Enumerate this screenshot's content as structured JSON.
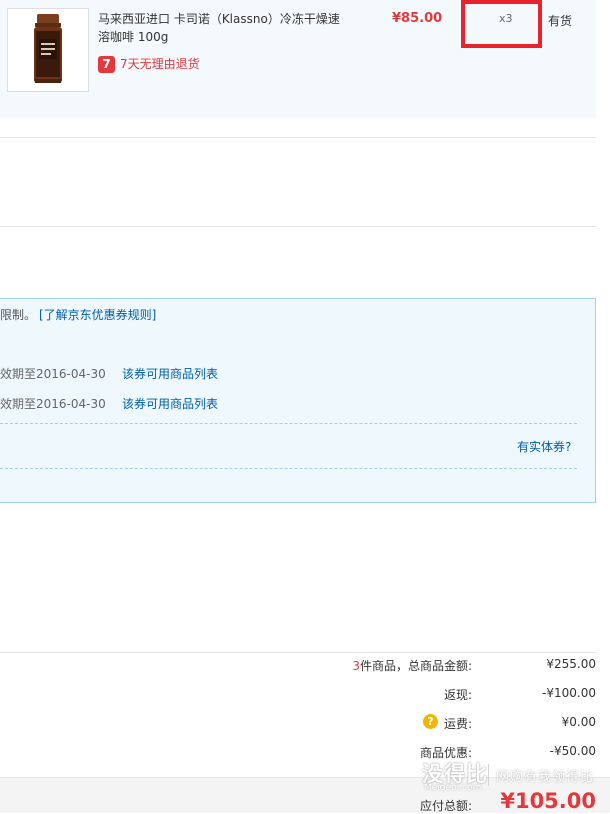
{
  "product": {
    "title": "马来西亚进口 卡司诺（Klassno）冷冻干燥速溶咖啡 100g",
    "return_badge": "7",
    "return_text": "7天无理由退货",
    "price": "¥85.00",
    "quantity": "x3",
    "stock": "有货",
    "image_icon": "coffee-jar-icon"
  },
  "coupons": {
    "notice_prefix": "限制。",
    "rules_link": "[了解京东优惠券规则]",
    "items": [
      {
        "expiry": "效期至2016-04-30",
        "link": "该券可用商品列表"
      },
      {
        "expiry": "效期至2016-04-30",
        "link": "该券可用商品列表"
      }
    ],
    "physical_coupon_link": "有实体券?"
  },
  "summary": {
    "item_count": "3",
    "total_label_suffix": "件商品，总商品金额:",
    "total_goods": "¥255.00",
    "rebate_label": "返现:",
    "rebate": "-¥100.00",
    "shipping_icon": "question-mark-icon",
    "shipping_label": "运费:",
    "shipping": "¥0.00",
    "discount_label": "商品优惠:",
    "discount": "-¥50.00",
    "payable_label": "应付总额:",
    "payable": "¥105.00"
  },
  "watermark": {
    "main": "没得比",
    "sub": "Meidebi.com",
    "slogan": "网购有我领得比"
  },
  "colors": {
    "price_red": "#e4393c",
    "highlight_red": "#e8232b",
    "link_blue": "#005ea7",
    "panel_blue": "#eef8fd"
  }
}
